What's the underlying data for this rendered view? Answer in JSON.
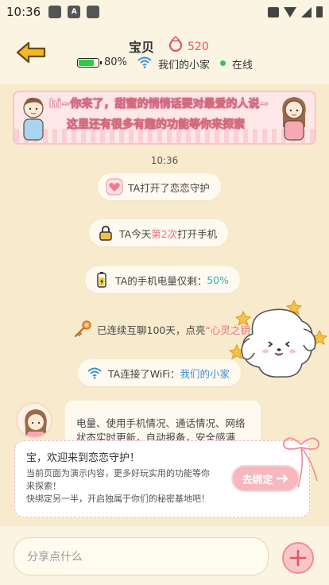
{
  "status_bar": {
    "time": "10:36",
    "notif_glyph": "A"
  },
  "header": {
    "title": "宝贝",
    "score": "520",
    "battery_percent": "80%",
    "battery_level": 0.8,
    "wifi_name": "我们的小家",
    "online_status": "在线"
  },
  "banner": {
    "line1": "hi~你来了，甜蜜的悄悄话要对最爱的人说~",
    "line2": "这里还有很多有趣的功能等你来探索"
  },
  "chat": {
    "timestamp": "10:36",
    "msg1": "TA打开了恋恋守护",
    "msg2_prefix": "TA今天",
    "msg2_highlight": "第2次",
    "msg2_suffix": "打开手机",
    "msg3_prefix": "TA的手机电量仅剩：",
    "msg3_highlight": "50%",
    "msg4_prefix": "已连续互聊100天，点亮",
    "msg4_highlight": "“心灵之钥",
    "msg5_prefix": "TA连接了WiFi：",
    "msg5_highlight": "我们的小家",
    "bubble_line1": "电量、使用手机情况、通话情况、网络",
    "bubble_line2": "状态实时更新，自动报备，安全感满"
  },
  "popup": {
    "title": "宝，欢迎来到恋恋守护！",
    "body_line1": "当前页面为演示内容，更多好玩实用的功能等你",
    "body_line2": "来探索！",
    "body_line3": "快绑定另一半，开启独属于你们的秘密基地吧！",
    "bind_button": "去绑定"
  },
  "input": {
    "placeholder": "分享点什么"
  },
  "colors": {
    "accent_pink": "#ef6b7a",
    "teal": "#2bb3a9",
    "blue": "#3b8fd8",
    "bg": "#f8ebcd",
    "back_arrow": "#f5b81f"
  }
}
